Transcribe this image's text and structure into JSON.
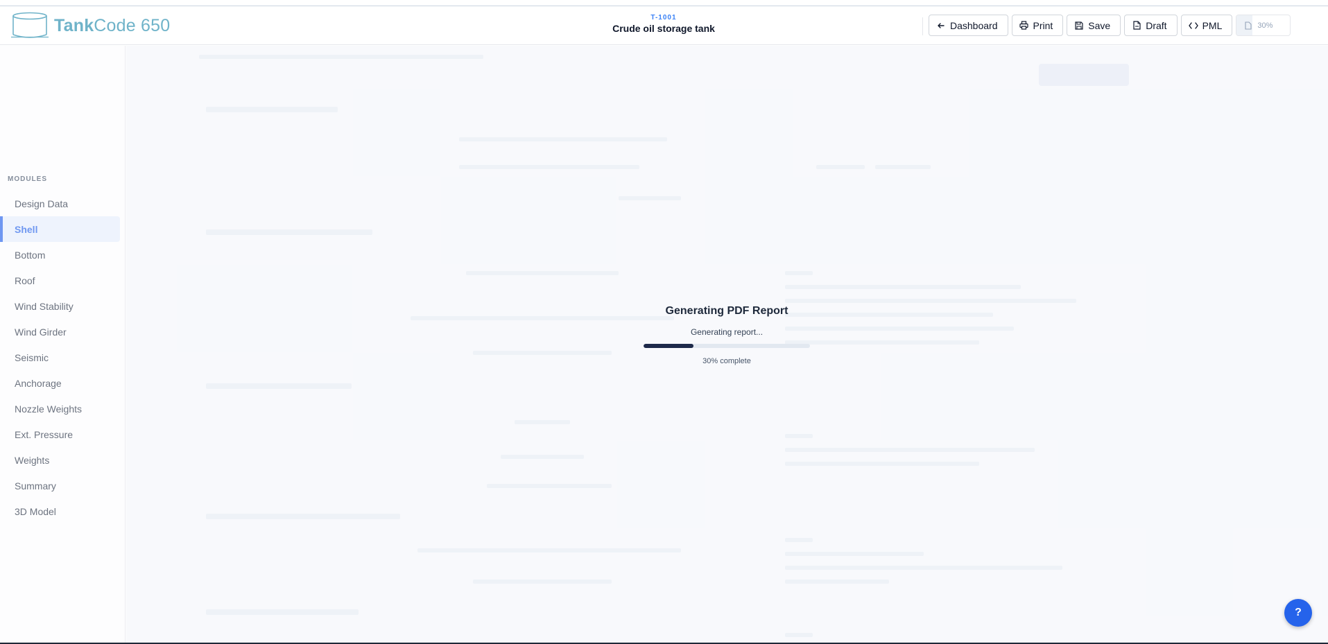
{
  "app": {
    "logo_main": "Tank",
    "logo_rest": "Code 650"
  },
  "project": {
    "tag": "T-1001",
    "name": "Crude oil storage tank"
  },
  "toolbar": {
    "dashboard_label": "Dashboard",
    "print_label": "Print",
    "save_label": "Save",
    "draft_label": "Draft",
    "pml_label": "PML",
    "progress_label": "30%",
    "progress_fraction": 0.3
  },
  "sidebar": {
    "heading": "MODULES",
    "items": [
      {
        "label": "Design Data"
      },
      {
        "label": "Shell",
        "active": true
      },
      {
        "label": "Bottom"
      },
      {
        "label": "Roof"
      },
      {
        "label": "Wind Stability"
      },
      {
        "label": "Wind Girder"
      },
      {
        "label": "Seismic"
      },
      {
        "label": "Anchorage"
      },
      {
        "label": "Nozzle Weights"
      },
      {
        "label": "Ext. Pressure"
      },
      {
        "label": "Weights"
      },
      {
        "label": "Summary"
      },
      {
        "label": "3D Model"
      }
    ]
  },
  "modal": {
    "title": "Generating PDF Report",
    "status": "Generating report...",
    "progress_fraction": 0.3,
    "progress_text": "30% complete"
  },
  "help": {
    "label": "?"
  },
  "colors": {
    "accent": "#2563eb",
    "logo": "#6fb3c9",
    "progress": "#1e2a4a"
  }
}
